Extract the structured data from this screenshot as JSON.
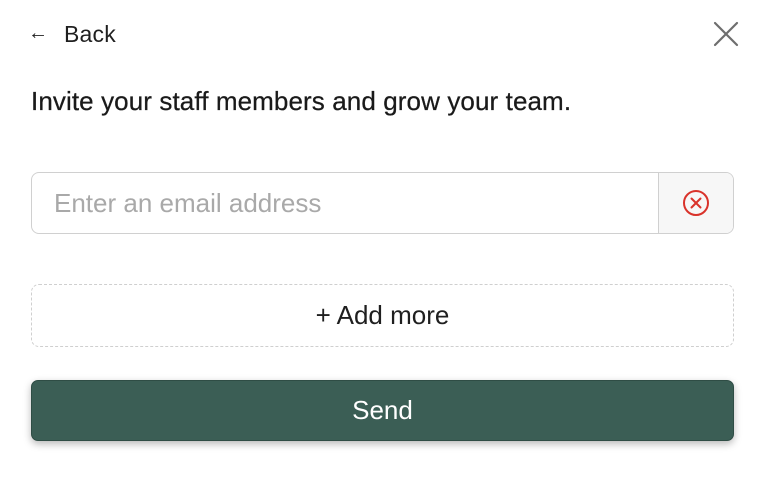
{
  "header": {
    "back_arrow": "←",
    "back_label": "Back",
    "close_icon": "close-icon"
  },
  "headline": "Invite your staff members and grow your team.",
  "email_field": {
    "value": "",
    "placeholder": "Enter an email address",
    "remove_icon": "circle-x-icon",
    "remove_icon_color": "#d9332b"
  },
  "add_more_label": "+ Add more",
  "send_button": {
    "label": "Send",
    "color": "#3b5e55"
  }
}
